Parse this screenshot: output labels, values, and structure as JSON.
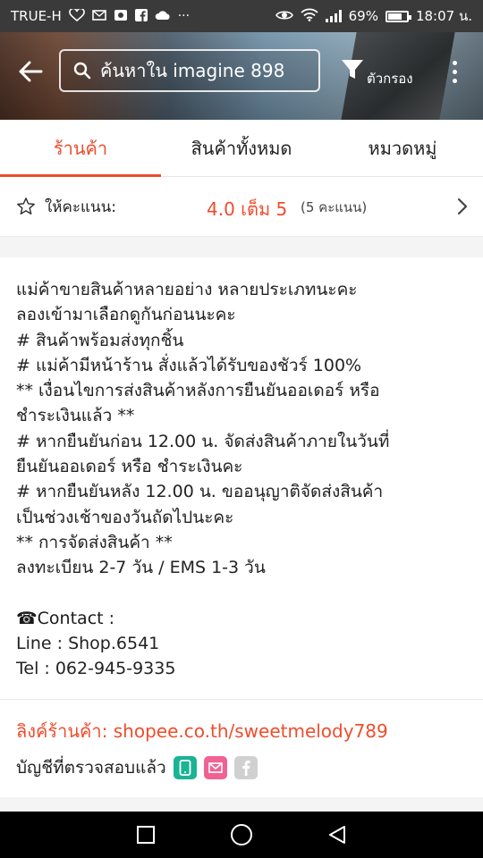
{
  "status_bar": {
    "carrier": "TRUE-H",
    "battery": "69%",
    "battery_level": 0.69,
    "time": "18:07 น."
  },
  "header": {
    "search_placeholder": "ค้นหาใน imagine 898",
    "filter_label": "ตัวกรอง"
  },
  "tabs": [
    {
      "label": "ร้านค้า",
      "active": true
    },
    {
      "label": "สินค้าทั้งหมด",
      "active": false
    },
    {
      "label": "หมวดหมู่",
      "active": false
    }
  ],
  "rating": {
    "label": "ให้คะแนน:",
    "score": "4.0 เต็ม 5",
    "count": "(5 คะแนน)"
  },
  "description": {
    "lines": [
      "แม่ค้าขายสินค้าหลายอย่าง หลายประเภทนะคะ",
      "ลองเข้ามาเลือกดูกันก่อนนะคะ",
      "# สินค้าพร้อมส่งทุกชิ้น",
      "# แม่ค้ามีหน้าร้าน สั่งแล้วได้รับของชัวร์ 100%",
      "** เงื่อนไขการส่งสินค้าหลังการยืนยันออเดอร์ หรือ",
      "ชำระเงินแล้ว **",
      "# หากยืนยันก่อน 12.00 น. จัดส่งสินค้าภายในวันที่",
      "ยืนยันออเดอร์ หรือ ชำระเงินคะ",
      "# หากยืนยันหลัง 12.00 น. ขออนุญาติจัดส่งสินค้า",
      "เป็นช่วงเช้าของวันถัดไปนะคะ",
      "** การจัดส่งสินค้า **",
      "ลงทะเบียน 2-7 วัน / EMS 1-3 วัน",
      "",
      "☎Contact :",
      "Line : Shop.6541",
      "Tel : 062-945-9335"
    ]
  },
  "shop_link": "ลิงค์ร้านค้า: shopee.co.th/sweetmelody789",
  "verified_label": "บัญชีที่ตรวจสอบแล้ว",
  "verified_badges": [
    {
      "icon": "phone-icon",
      "color": "#1ab394"
    },
    {
      "icon": "email-icon",
      "color": "#f06292"
    },
    {
      "icon": "facebook-icon",
      "color": "#d0d0d0"
    }
  ],
  "colors": {
    "accent": "#ee4d2d",
    "status_bar": "#3a3a3a",
    "nav_bar": "#000000"
  }
}
